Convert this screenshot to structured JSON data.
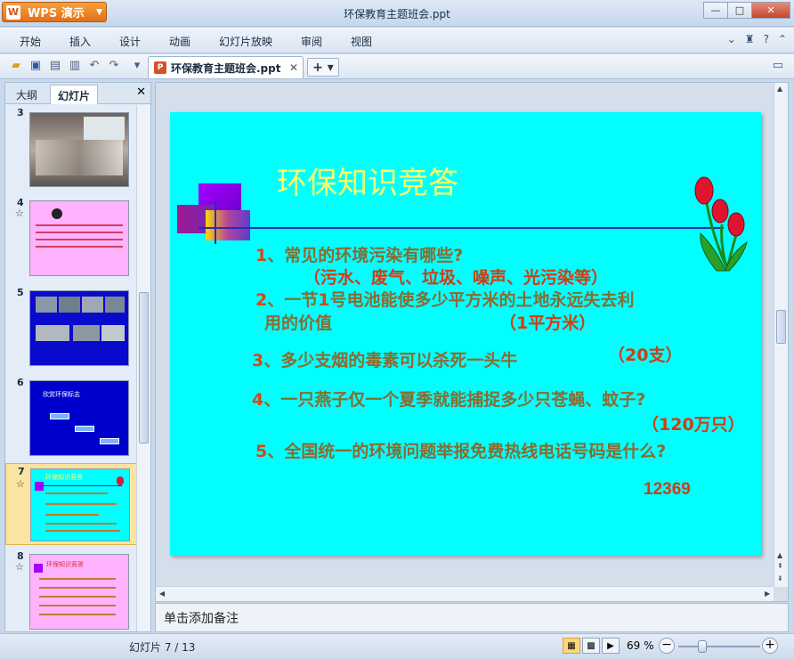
{
  "window": {
    "app_button": "WPS 演示",
    "title": "环保教育主题班会.ppt",
    "minimize": "—",
    "maximize": "□",
    "close": "✕"
  },
  "menu": {
    "items": [
      "开始",
      "插入",
      "设计",
      "动画",
      "幻灯片放映",
      "审阅",
      "视图"
    ]
  },
  "tabs": {
    "document_tab": "环保教育主题班会.ppt",
    "new_tab": "+ ▾"
  },
  "left_pane": {
    "tab_outline": "大纲",
    "tab_slides": "幻灯片",
    "close": "✕",
    "thumbnails": [
      {
        "num": "3",
        "star": "",
        "bg": "#9c8f86"
      },
      {
        "num": "4",
        "star": "☆",
        "bg": "#ffb3ff"
      },
      {
        "num": "5",
        "star": "",
        "bg": "#0a0acc"
      },
      {
        "num": "6",
        "star": "",
        "bg": "#0000cc"
      },
      {
        "num": "7",
        "star": "☆",
        "bg": "#00ffff",
        "title": "环保知识竞答"
      },
      {
        "num": "8",
        "star": "☆",
        "bg": "#ffb3ff",
        "title": "环保知识竞答"
      }
    ],
    "thumb6_title": "欣赏环保标志"
  },
  "slide": {
    "title": "环保知识竞答",
    "q1_num": "1",
    "q1_text": "、常见的环境污染有哪些?",
    "a1": "（污水、废气、垃圾、噪声、光污染等）",
    "q2_num": "2",
    "q2_text_a": "、一节",
    "q2_bold": "1",
    "q2_text_b": "号电池能使多少平方米的土地永远失去利",
    "q2_line2": "用的价值",
    "a2": "（1平方米）",
    "q3_num": "3",
    "q3_text": "、多少支烟的毒素可以杀死一头牛",
    "a3": "（20支）",
    "q4_num": "4",
    "q4_text": "、一只燕子仅一个夏季就能捕捉多少只苍蝇、蚊子?",
    "a4": "（120万只）",
    "q5_num": "5",
    "q5_text": "、全国统一的环境问题举报免费热线电话号码是什么?",
    "a5": "12369"
  },
  "notes": {
    "placeholder": "单击添加备注"
  },
  "status": {
    "slide_counter": "幻灯片 7 / 13",
    "zoom": "69 %"
  },
  "colors": {
    "slide_bg": "#00ffff",
    "title": "#ffff66",
    "question": "#8b6b2e",
    "answer": "#d23c12"
  }
}
